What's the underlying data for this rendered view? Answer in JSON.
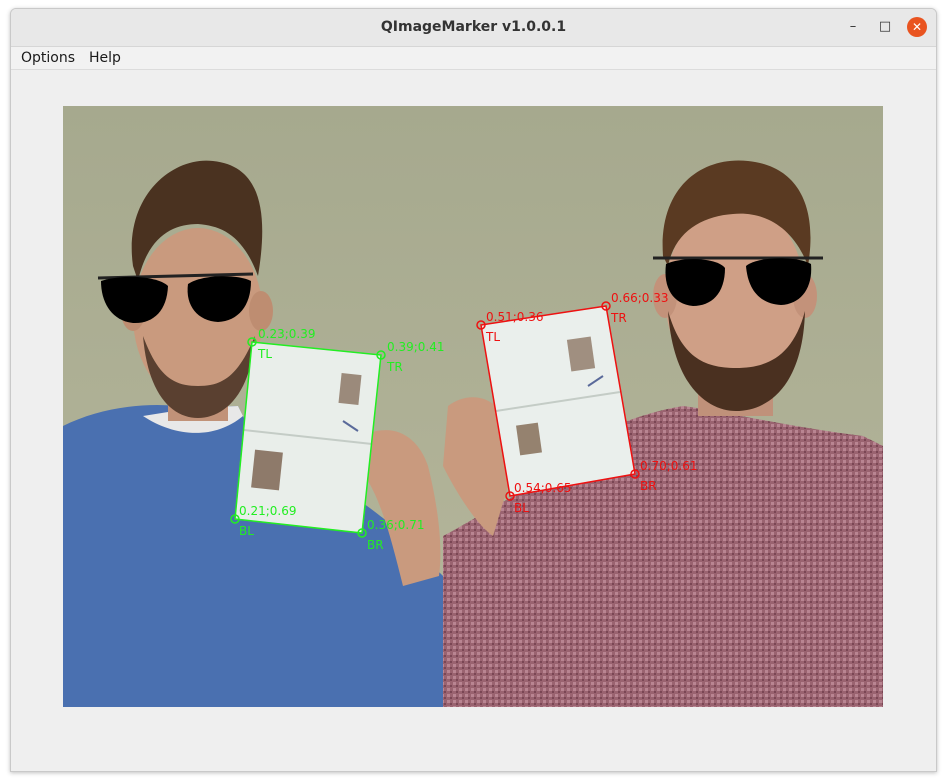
{
  "window": {
    "title": "QImageMarker v1.0.0.1",
    "min_icon": "minimize-icon",
    "max_icon": "maximize-icon",
    "close_icon": "close-icon"
  },
  "menu": {
    "options": "Options",
    "help": "Help"
  },
  "image": {
    "subjects": "two men wearing black aviator sunglasses holding open passports",
    "colors": {
      "background": "#a8ac8f",
      "left_shirt": "#4a70b0",
      "right_sweater": "#9a6370",
      "skin": "#c99a7e",
      "hair": "#4a3220"
    }
  },
  "markers": [
    {
      "color": "#22ee22",
      "corners": [
        {
          "tag": "TL",
          "coord": "0.23;0.39"
        },
        {
          "tag": "TR",
          "coord": "0.39;0.41"
        },
        {
          "tag": "BR",
          "coord": "0.36;0.71"
        },
        {
          "tag": "BL",
          "coord": "0.21;0.69"
        }
      ]
    },
    {
      "color": "#ee1111",
      "corners": [
        {
          "tag": "TL",
          "coord": "0.51;0.36"
        },
        {
          "tag": "TR",
          "coord": "0.66;0.33"
        },
        {
          "tag": "BR",
          "coord": "0.70;0.61"
        },
        {
          "tag": "BL",
          "coord": "0.54;0.65"
        }
      ]
    }
  ]
}
